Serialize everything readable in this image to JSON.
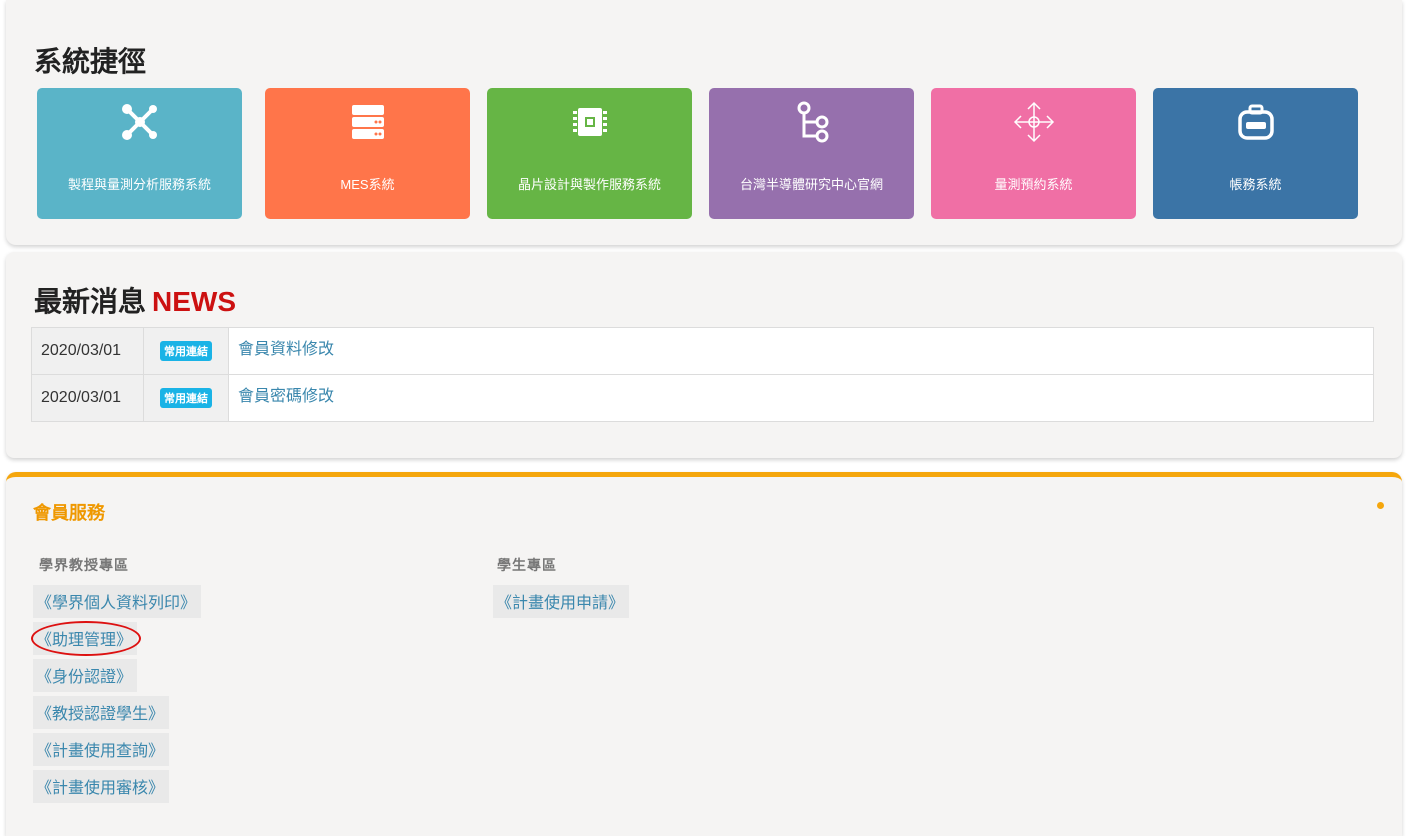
{
  "shortcuts": {
    "title": "系統捷徑",
    "tiles": [
      {
        "label": "製程與量測分析服務系統",
        "color": "#5ab4c8",
        "icon": "molecule-icon"
      },
      {
        "label": "MES系統",
        "color": "#ff754a",
        "icon": "server-icon"
      },
      {
        "label": "晶片設計與製作服務系統",
        "color": "#66b545",
        "icon": "chip-icon"
      },
      {
        "label": "台灣半導體研究中心官網",
        "color": "#9670ad",
        "icon": "git-branch-icon"
      },
      {
        "label": "量測預約系統",
        "color": "#f06fa5",
        "icon": "move-arrows-icon"
      },
      {
        "label": "帳務系統",
        "color": "#3b74a6",
        "icon": "toolbox-icon"
      }
    ]
  },
  "news": {
    "title": "最新消息",
    "title_en": "NEWS",
    "rows": [
      {
        "date": "2020/03/01",
        "tag": "常用連結",
        "title": "會員資料修改"
      },
      {
        "date": "2020/03/01",
        "tag": "常用連結",
        "title": "會員密碼修改"
      }
    ]
  },
  "member": {
    "title": "會員服務",
    "professor": {
      "heading": "學界教授專區",
      "links": [
        "《學界個人資料列印》",
        "《助理管理》",
        "《身份認證》",
        "《教授認證學生》",
        "《計畫使用查詢》",
        "《計畫使用審核》"
      ]
    },
    "student": {
      "heading": "學生專區",
      "links": [
        "《計畫使用申請》"
      ]
    }
  },
  "colors": {
    "accent_orange": "#f5a60c",
    "news_red": "#cc1111",
    "link_blue": "#3a87ad",
    "tag_blue": "#1ab3e6",
    "annotation_red": "#dd1111"
  }
}
